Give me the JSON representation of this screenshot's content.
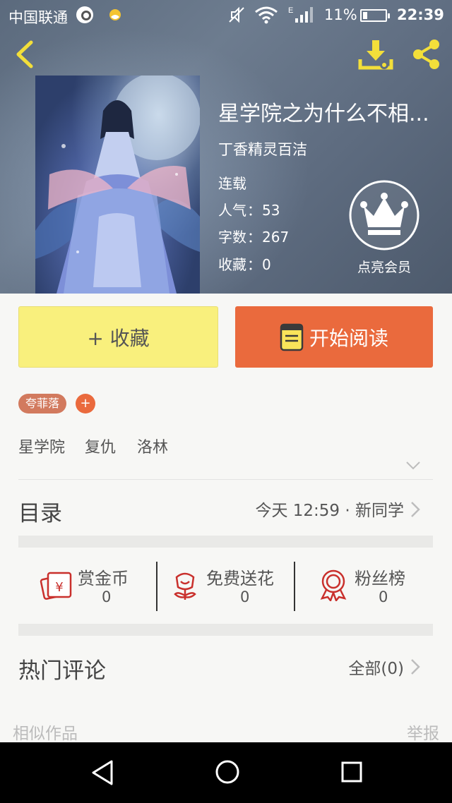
{
  "status_bar": {
    "carrier": "中国联通",
    "battery": "11%",
    "time": "22:39"
  },
  "book": {
    "title": "星学院之为什么不相...",
    "author": "丁香精灵百洁",
    "status": "连载",
    "popularity_label": "人气",
    "popularity": "53",
    "words_label": "字数",
    "words": "267",
    "favorites_label": "收藏",
    "favorites": "0"
  },
  "vip": {
    "label": "点亮会员"
  },
  "actions": {
    "collect_label": "+ 收藏",
    "read_label": "开始阅读"
  },
  "tags": {
    "fan_tag": "夸菲落",
    "add": "+",
    "keywords": [
      "星学院",
      "复仇",
      "洛林"
    ]
  },
  "catalog": {
    "title": "目录",
    "update": "今天 12:59 · 新同学"
  },
  "rewards": [
    {
      "label": "赏金币",
      "count": "0",
      "icon": "coin-icon"
    },
    {
      "label": "免费送花",
      "count": "0",
      "icon": "flower-icon"
    },
    {
      "label": "粉丝榜",
      "count": "0",
      "icon": "medal-icon"
    }
  ],
  "comments": {
    "title": "热门评论",
    "all": "全部(0)"
  },
  "footer": {
    "similar": "相似作品",
    "report": "举报"
  },
  "colors": {
    "accent": "#ea6a3d",
    "collect_bg": "#f9f07d",
    "icon_red": "#c9302c",
    "header_bg": "#5e6c80"
  }
}
